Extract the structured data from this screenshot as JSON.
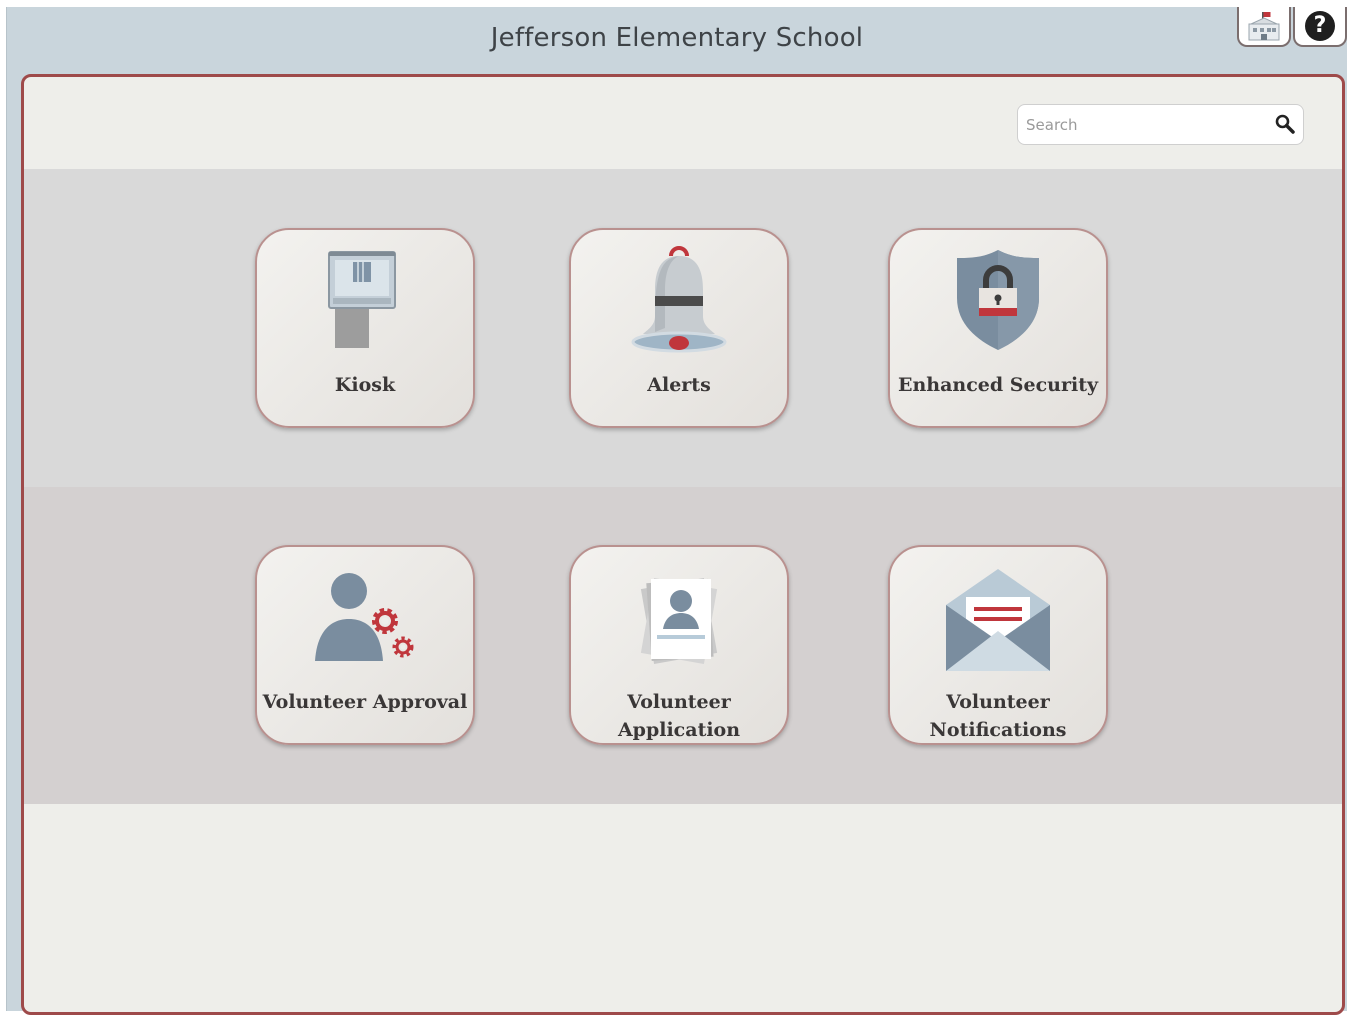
{
  "app": {
    "title": "Jefferson Elementary School"
  },
  "header_buttons": {
    "school": {
      "icon": "school-building-icon"
    },
    "help": {
      "icon": "help-icon",
      "glyph": "?"
    }
  },
  "search": {
    "placeholder": "Search",
    "value": "",
    "icon": "search-icon"
  },
  "tiles_row1": [
    {
      "label": "Kiosk",
      "icon": "kiosk-icon"
    },
    {
      "label": "Alerts",
      "icon": "bell-icon"
    },
    {
      "label": "Enhanced Security",
      "icon": "shield-lock-icon"
    }
  ],
  "tiles_row2": [
    {
      "label": "Volunteer Approval",
      "icon": "user-gear-icon"
    },
    {
      "label_line1": "Volunteer",
      "label_line2": "Application",
      "icon": "id-document-icon"
    },
    {
      "label_line1": "Volunteer",
      "label_line2": "Notifications",
      "icon": "envelope-icon"
    }
  ],
  "colors": {
    "header_bg": "#c9d5dc",
    "panel_border": "#9e4a4a",
    "tile_border": "#b9918f",
    "icon_slate": "#7a8d9f",
    "icon_red": "#c0363c"
  }
}
